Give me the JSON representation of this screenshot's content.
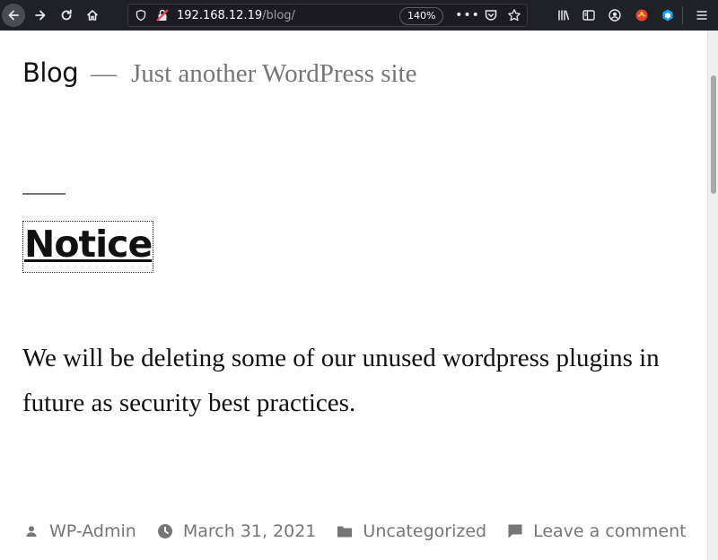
{
  "browser": {
    "url_host": "192.168.12.19",
    "url_path": "/blog/",
    "zoom": "140%"
  },
  "site": {
    "title": "Blog",
    "separator": "—",
    "description": "Just another WordPress site"
  },
  "post": {
    "title": "Notice",
    "content": "We will be deleting some of our unused wordpress plugins in future as security best practices.",
    "meta": {
      "author": "WP-Admin",
      "date": "March 31, 2021",
      "category": "Uncategorized",
      "comment_link": "Leave a comment"
    }
  },
  "icons": {
    "back": "back-arrow-icon",
    "forward": "forward-arrow-icon",
    "reload": "reload-icon",
    "home": "home-icon",
    "shield": "shield-icon",
    "insecure": "insecure-lock-icon",
    "more": "more-icon",
    "pocket": "pocket-icon",
    "bookmark": "star-icon",
    "library": "library-icon",
    "sidebar": "sidebar-icon",
    "account": "account-icon",
    "extension1": "extension-icon",
    "extension2": "extension-icon",
    "menu": "hamburger-menu-icon"
  },
  "colors": {
    "toolbar_bg": "#202126",
    "page_bg": "#ffffff",
    "text": "#111111",
    "muted": "#767676"
  }
}
